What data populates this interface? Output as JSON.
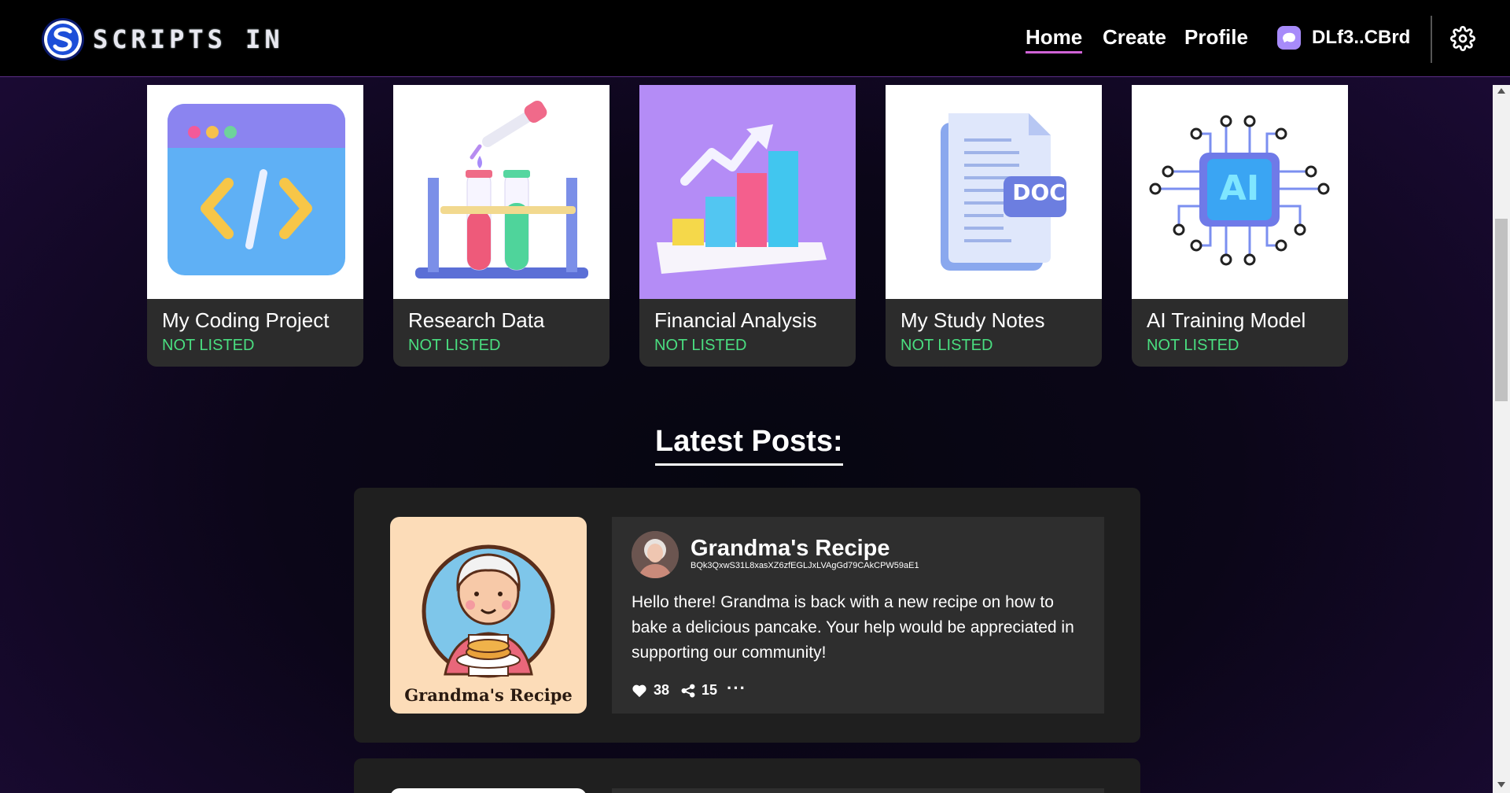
{
  "header": {
    "logo_text": "SCRIPTS IN",
    "nav": [
      "Home",
      "Create",
      "Profile"
    ],
    "wallet_label": "DLf3..CBrd"
  },
  "cards": [
    {
      "title": "My Coding Project",
      "status": "NOT LISTED"
    },
    {
      "title": "Research Data",
      "status": "NOT LISTED"
    },
    {
      "title": "Financial Analysis",
      "status": "NOT LISTED"
    },
    {
      "title": "My Study Notes",
      "status": "NOT LISTED"
    },
    {
      "title": "AI Training Model",
      "status": "NOT LISTED"
    }
  ],
  "card_image_text": {
    "doc": "DOC",
    "ai": "AI"
  },
  "section_title": "Latest Posts:",
  "post": {
    "image_caption": "Grandma's Recipe",
    "title": "Grandma's Recipe",
    "address": "BQk3QxwS31L8xasXZ6zfEGLJxLVAgGd79CAkCPW59aE1",
    "text": "Hello there! Grandma is back with a new recipe on how to bake a delicious pancake. Your help would be appreciated in supporting our community!",
    "likes": "38",
    "shares": "15",
    "more": "···"
  },
  "colors": {
    "accent": "#d063d6",
    "status_green": "#4ade80",
    "wallet": "#a78bfa"
  },
  "icons": [
    "logo-icon",
    "wallet-icon",
    "gear-icon",
    "heart-icon",
    "share-icon",
    "more-icon"
  ]
}
